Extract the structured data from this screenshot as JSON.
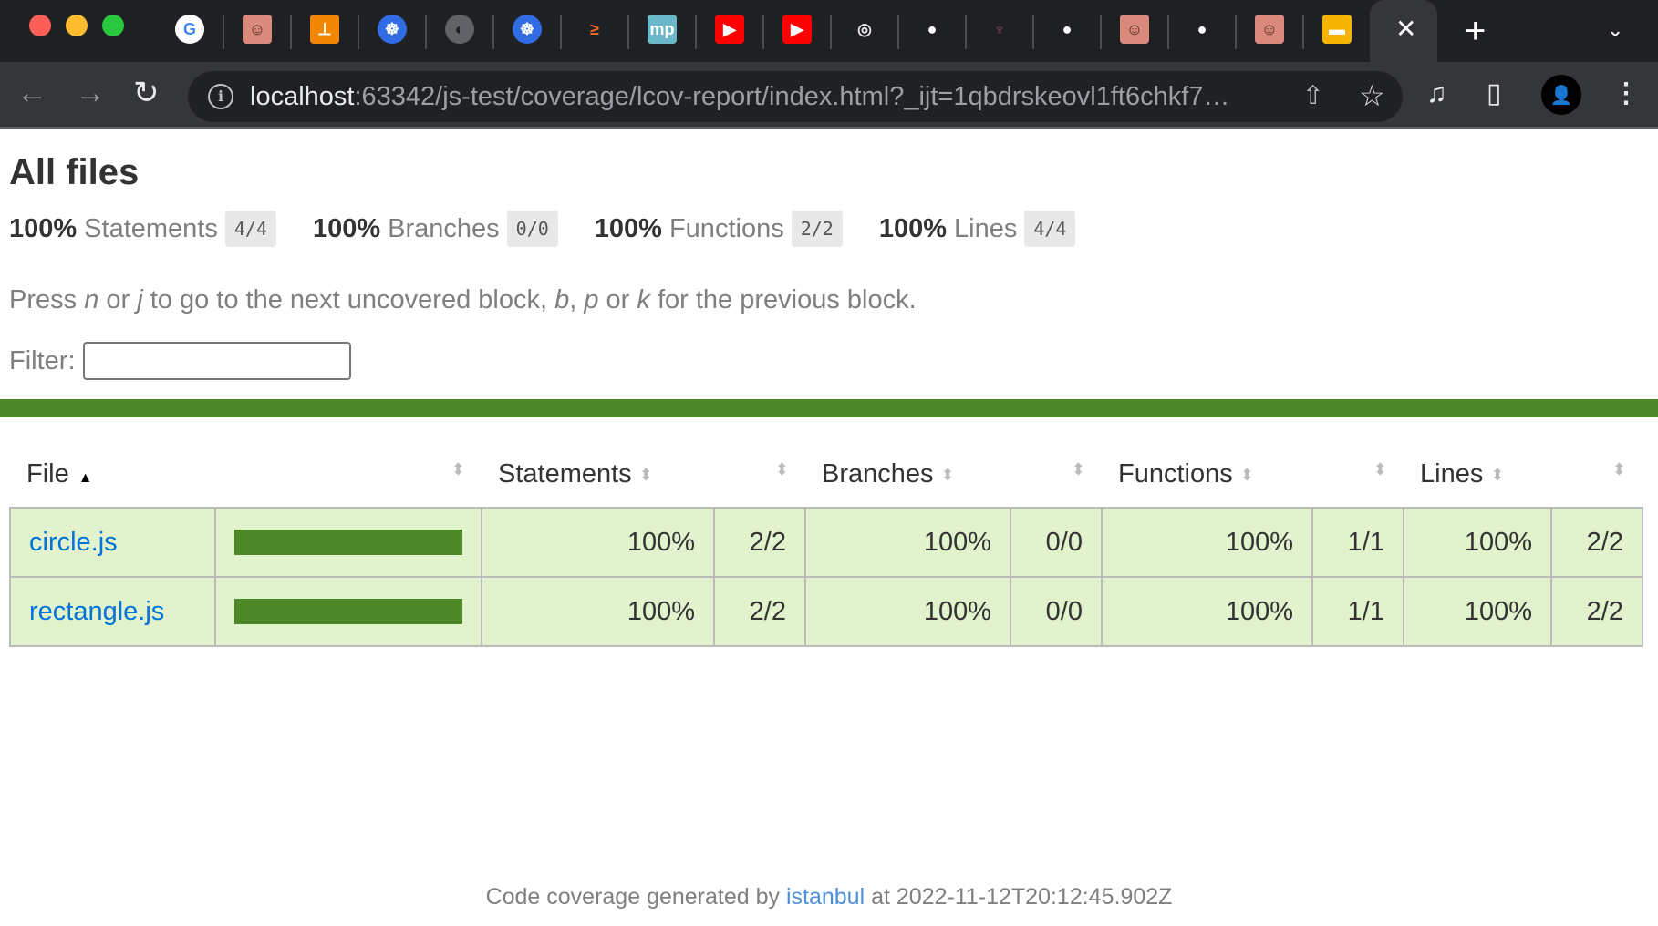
{
  "browser": {
    "tabs": [
      {
        "icon": "google-icon",
        "glyph": "G",
        "bg": "#ffffff",
        "fg": "#4285f4",
        "round": true
      },
      {
        "icon": "avatar-photo-icon",
        "glyph": "☺",
        "bg": "#d98a7c",
        "fg": "#5a2a20",
        "round": false
      },
      {
        "icon": "drawio-icon",
        "glyph": "⊥",
        "bg": "#f08705",
        "fg": "#ffffff",
        "round": false
      },
      {
        "icon": "kubernetes-icon",
        "glyph": "☸",
        "bg": "#326ce5",
        "fg": "#ffffff",
        "round": true
      },
      {
        "icon": "globe-icon",
        "glyph": "◐",
        "bg": "#5f6368",
        "fg": "#1f2023",
        "round": true
      },
      {
        "icon": "kubernetes-icon",
        "glyph": "☸",
        "bg": "#326ce5",
        "fg": "#ffffff",
        "round": true
      },
      {
        "icon": "terminal-icon",
        "glyph": "≥",
        "bg": "#1f2023",
        "fg": "#e8682a",
        "round": false
      },
      {
        "icon": "mp-icon",
        "glyph": "mp",
        "bg": "#6ab7c9",
        "fg": "#ffffff",
        "round": false
      },
      {
        "icon": "youtube-icon",
        "glyph": "▶",
        "bg": "#ff0000",
        "fg": "#ffffff",
        "round": false
      },
      {
        "icon": "youtube-icon",
        "glyph": "▶",
        "bg": "#ff0000",
        "fg": "#ffffff",
        "round": false
      },
      {
        "icon": "chrome-icon",
        "glyph": "◎",
        "bg": "#1f2023",
        "fg": "#e8eaed",
        "round": true
      },
      {
        "icon": "github-icon",
        "glyph": "●",
        "bg": "#1f2023",
        "fg": "#ffffff",
        "round": true
      },
      {
        "icon": "jest-icon",
        "glyph": "♆",
        "bg": "#1f2023",
        "fg": "#99425b",
        "round": false
      },
      {
        "icon": "github-icon",
        "glyph": "●",
        "bg": "#1f2023",
        "fg": "#ffffff",
        "round": true
      },
      {
        "icon": "avatar-photo-icon",
        "glyph": "☺",
        "bg": "#d98a7c",
        "fg": "#5a2a20",
        "round": false
      },
      {
        "icon": "github-icon",
        "glyph": "●",
        "bg": "#1f2023",
        "fg": "#ffffff",
        "round": true
      },
      {
        "icon": "avatar-photo-icon",
        "glyph": "☺",
        "bg": "#d98a7c",
        "fg": "#5a2a20",
        "round": false
      },
      {
        "icon": "slides-icon",
        "glyph": "▬",
        "bg": "#f4b400",
        "fg": "#ffffff",
        "round": false
      }
    ],
    "active_tab_close": "✕",
    "new_tab": "+",
    "tab_menu": "⌄",
    "url_host": "localhost",
    "url_rest": ":63342/js-test/coverage/lcov-report/index.html?_ijt=1qbdrskeovl1ft6chkf7…",
    "back": "←",
    "forward": "→",
    "reload": "↻",
    "info": "i",
    "share": "⇧",
    "star": "☆",
    "media": "♫",
    "sidepanel": "▯",
    "profile": "👤",
    "menu": "⋮"
  },
  "page": {
    "title": "All files",
    "summary": [
      {
        "pct": "100%",
        "label": "Statements",
        "fraction": "4/4"
      },
      {
        "pct": "100%",
        "label": "Branches",
        "fraction": "0/0"
      },
      {
        "pct": "100%",
        "label": "Functions",
        "fraction": "2/2"
      },
      {
        "pct": "100%",
        "label": "Lines",
        "fraction": "4/4"
      }
    ],
    "hint": {
      "p1": "Press ",
      "k1": "n",
      "p2": " or ",
      "k2": "j",
      "p3": " to go to the next uncovered block, ",
      "k3": "b",
      "p4": ", ",
      "k4": "p",
      "p5": " or ",
      "k5": "k",
      "p6": " for the previous block."
    },
    "filter_label": "Filter:",
    "filter_value": "",
    "status_color": "#4d8727",
    "table": {
      "headers": [
        "File",
        "Statements",
        "Branches",
        "Functions",
        "Lines"
      ],
      "sort_asc": "▲",
      "sorter": "⬍",
      "rows": [
        {
          "file": "circle.js",
          "coverage": 100,
          "statements_pct": "100%",
          "statements": "2/2",
          "branches_pct": "100%",
          "branches": "0/0",
          "functions_pct": "100%",
          "functions": "1/1",
          "lines_pct": "100%",
          "lines": "2/2"
        },
        {
          "file": "rectangle.js",
          "coverage": 100,
          "statements_pct": "100%",
          "statements": "2/2",
          "branches_pct": "100%",
          "branches": "0/0",
          "functions_pct": "100%",
          "functions": "1/1",
          "lines_pct": "100%",
          "lines": "2/2"
        }
      ]
    },
    "footer": {
      "prefix": "Code coverage generated by ",
      "link": "istanbul",
      "suffix": " at 2022-11-12T20:12:45.902Z"
    }
  }
}
